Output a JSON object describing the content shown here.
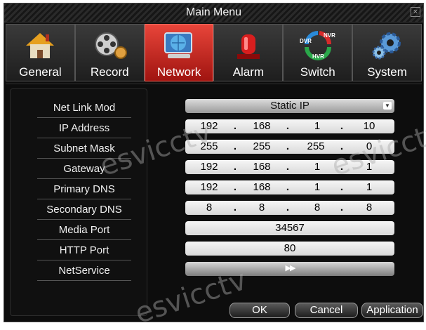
{
  "window": {
    "title": "Main Menu",
    "close_glyph": "×"
  },
  "tabs": [
    {
      "label": "General",
      "icon": "house-icon"
    },
    {
      "label": "Record",
      "icon": "film-reel-icon"
    },
    {
      "label": "Network",
      "icon": "globe-icon"
    },
    {
      "label": "Alarm",
      "icon": "siren-icon"
    },
    {
      "label": "Switch",
      "icon": "dvr-nvr-hvr-icon"
    },
    {
      "label": "System",
      "icon": "gears-icon"
    }
  ],
  "active_tab": "Network",
  "switch_icon_text": {
    "dvr": "DVR",
    "nvr": "NVR",
    "hvr": "HVR"
  },
  "network": {
    "labels": {
      "net_link_mode": "Net Link Mod",
      "ip_address": "IP Address",
      "subnet_mask": "Subnet Mask",
      "gateway": "Gateway",
      "primary_dns": "Primary DNS",
      "secondary_dns": "Secondary DNS",
      "media_port": "Media Port",
      "http_port": "HTTP Port",
      "netservice": "NetService"
    },
    "net_link_mode_value": "Static IP",
    "ip_address": [
      "192",
      "168",
      "1",
      "10"
    ],
    "subnet_mask": [
      "255",
      "255",
      "255",
      "0"
    ],
    "gateway": [
      "192",
      "168",
      "1",
      "1"
    ],
    "primary_dns": [
      "192",
      "168",
      "1",
      "1"
    ],
    "secondary_dns": [
      "8",
      "8",
      "8",
      "8"
    ],
    "media_port": "34567",
    "http_port": "80",
    "netservice_glyph": "▶▶",
    "dot": "."
  },
  "buttons": {
    "ok": "OK",
    "cancel": "Cancel",
    "apply": "Application"
  },
  "watermark": "esvicctv",
  "colors": {
    "active_tab": "#d42a20",
    "background": "#0d0d0d",
    "field": "#eeeeee"
  }
}
